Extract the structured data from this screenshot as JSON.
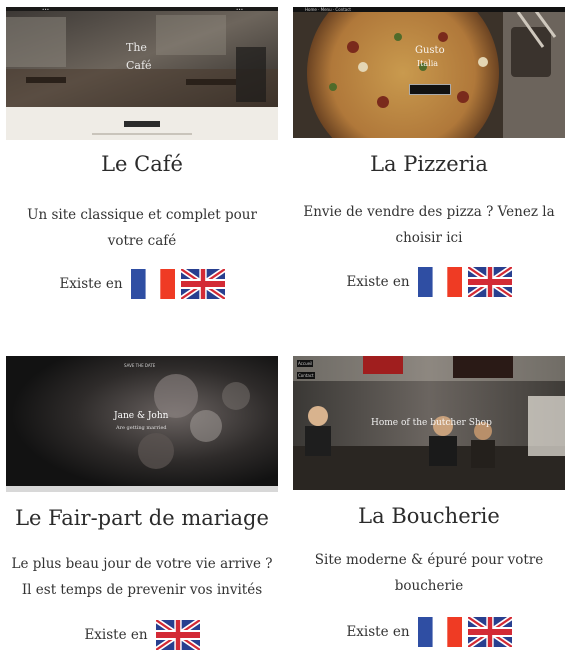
{
  "templates": [
    {
      "title": "Le Café",
      "description": "Un site classique et complet pour votre café",
      "exists_label": "Existe en",
      "languages": [
        "french-flag",
        "uk-flag"
      ],
      "preview": {
        "overlay_line1": "The",
        "overlay_line2": "Café"
      }
    },
    {
      "title": "La Pizzeria",
      "description": "Envie de vendre des pizza ? Venez la choisir ici",
      "exists_label": "Existe en",
      "languages": [
        "french-flag",
        "uk-flag"
      ],
      "preview": {
        "overlay_line1": "Gusto",
        "overlay_line2": "Italia"
      }
    },
    {
      "title": "Le Fair-part de mariage",
      "description": "Le plus beau jour de votre vie arrive ? Il est temps de prevenir vos invités",
      "exists_label": "Existe en",
      "languages": [
        "uk-flag"
      ],
      "preview": {
        "overlay_line1": "Jane & John",
        "overlay_line2": "Are getting married"
      }
    },
    {
      "title": "La Boucherie",
      "description": "Site moderne & épuré pour votre boucherie",
      "exists_label": "Existe en",
      "languages": [
        "french-flag",
        "uk-flag"
      ],
      "preview": {
        "overlay_line1": "Home of the butcher Shop"
      }
    }
  ],
  "colors": {
    "flag_blue": "#2f4ea3",
    "flag_red": "#ef3b24",
    "uk_blue": "#283f8f",
    "uk_red": "#d32a35"
  }
}
